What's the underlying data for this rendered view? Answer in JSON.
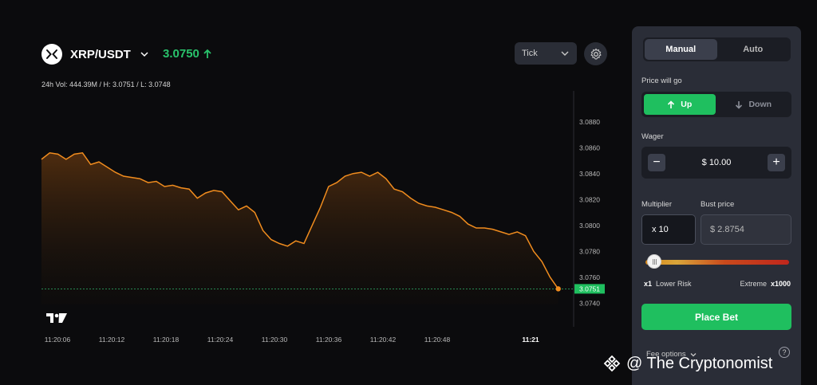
{
  "header": {
    "pair": "XRP/USDT",
    "price": "3.0750",
    "stats": "24h Vol: 444.39M / H: 3.0751 / L: 3.0748",
    "interval": "Tick"
  },
  "chart_data": {
    "type": "area",
    "x_ticks": [
      "11:20:06",
      "11:20:12",
      "11:20:18",
      "11:20:24",
      "11:20:30",
      "11:20:36",
      "11:20:42",
      "11:20:48",
      "11:21"
    ],
    "y_ticks": [
      "3.0880",
      "3.0860",
      "3.0840",
      "3.0820",
      "3.0800",
      "3.0780",
      "3.0760",
      "3.0740"
    ],
    "ylim": [
      3.0734,
      3.0894
    ],
    "current_label": "3.0751",
    "current_value": 3.0751,
    "x_range": [
      0,
      64
    ],
    "series": [
      {
        "color": "#f08c1e",
        "x": [
          0,
          1,
          2,
          3,
          4,
          5,
          6,
          7,
          8,
          9,
          10,
          11,
          12,
          13,
          14,
          15,
          16,
          17,
          18,
          19,
          20,
          21,
          22,
          23,
          24,
          25,
          26,
          27,
          28,
          29,
          30,
          31,
          32,
          33,
          34,
          35,
          36,
          37,
          38,
          39,
          40,
          41,
          42,
          43,
          44,
          45,
          46,
          47,
          48,
          49,
          50,
          51,
          52,
          53,
          54,
          55,
          56,
          57,
          58,
          59,
          60,
          61,
          62,
          63
        ],
        "values": [
          3.0851,
          3.0856,
          3.0855,
          3.0851,
          3.0855,
          3.0856,
          3.0847,
          3.0849,
          3.0845,
          3.0841,
          3.0838,
          3.0837,
          3.0836,
          3.0833,
          3.0834,
          3.083,
          3.0831,
          3.0829,
          3.0828,
          3.0821,
          3.0825,
          3.0827,
          3.0826,
          3.0819,
          3.0812,
          3.0815,
          3.081,
          3.0796,
          3.0789,
          3.0786,
          3.0784,
          3.0788,
          3.0786,
          3.08,
          3.0814,
          3.083,
          3.0833,
          3.0838,
          3.084,
          3.0841,
          3.0838,
          3.0841,
          3.0836,
          3.0828,
          3.0826,
          3.0821,
          3.0817,
          3.0815,
          3.0814,
          3.0812,
          3.081,
          3.0807,
          3.0801,
          3.0798,
          3.0798,
          3.0797,
          3.0795,
          3.0793,
          3.0795,
          3.0792,
          3.078,
          3.0772,
          3.076,
          3.0751
        ]
      }
    ]
  },
  "panel": {
    "tabs": [
      "Manual",
      "Auto"
    ],
    "direction_label": "Price will go",
    "up_label": "Up",
    "down_label": "Down",
    "wager_label": "Wager",
    "wager_value": "$ 10.00",
    "minus": "−",
    "plus": "+",
    "multiplier_label": "Multiplier",
    "multiplier_value": "x 10",
    "bust_label": "Bust price",
    "bust_value": "$ 2.8754",
    "slider_level": 0.02,
    "range_min": "x1",
    "range_min_label": "Lower Risk",
    "range_max_label": "Extreme",
    "range_max": "x1000",
    "place_bet": "Place Bet",
    "fee_options": "Fee options",
    "help": "?"
  },
  "watermark": "@ The Cryptonomist",
  "colors": {
    "accent_green": "#1fbf5f",
    "line": "#f08c1e",
    "panel": "#2a2d37"
  }
}
